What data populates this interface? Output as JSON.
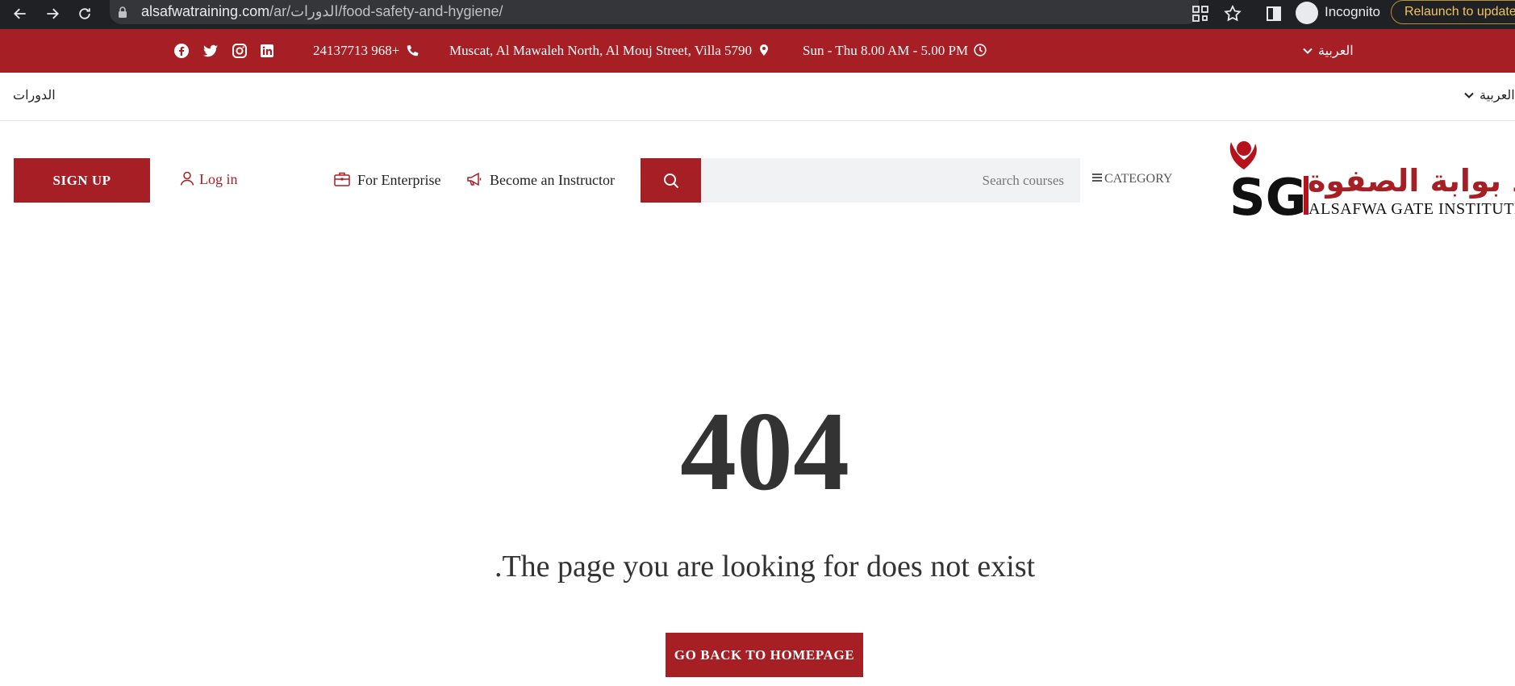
{
  "browser": {
    "url_host": "alsafwatraining.com",
    "url_path": "/ar/الدورات/food-safety-and-hygiene/",
    "incognito_label": "Incognito",
    "relaunch_label": "Relaunch to update"
  },
  "topbar": {
    "phone": "24137713 968+",
    "address": "Muscat, Al Mawaleh North, Al Mouj Street, Villa 5790",
    "hours": "Sun - Thu 8.00 AM - 5.00 PM",
    "language": "العربية",
    "social_icons": [
      "facebook-icon",
      "twitter-icon",
      "instagram-icon",
      "linkedin-icon"
    ]
  },
  "subnav": {
    "courses": "الدورات",
    "language": "العربية"
  },
  "header": {
    "signup": "SIGN UP",
    "login": "Log in",
    "enterprise": "For Enterprise",
    "instructor": "Become an Instructor",
    "search_placeholder": "Search courses",
    "category": "CATEGORY",
    "logo_arabic": "معهد بوابة الصفوة",
    "logo_english": "ALSAFWA GATE INSTITUTE"
  },
  "error": {
    "code": "404",
    "message": ".The page you are looking for does not exist",
    "home_button": "GO BACK TO HOMEPAGE"
  },
  "colors": {
    "brand_red": "#a51f25",
    "chrome_dark": "#202124"
  }
}
